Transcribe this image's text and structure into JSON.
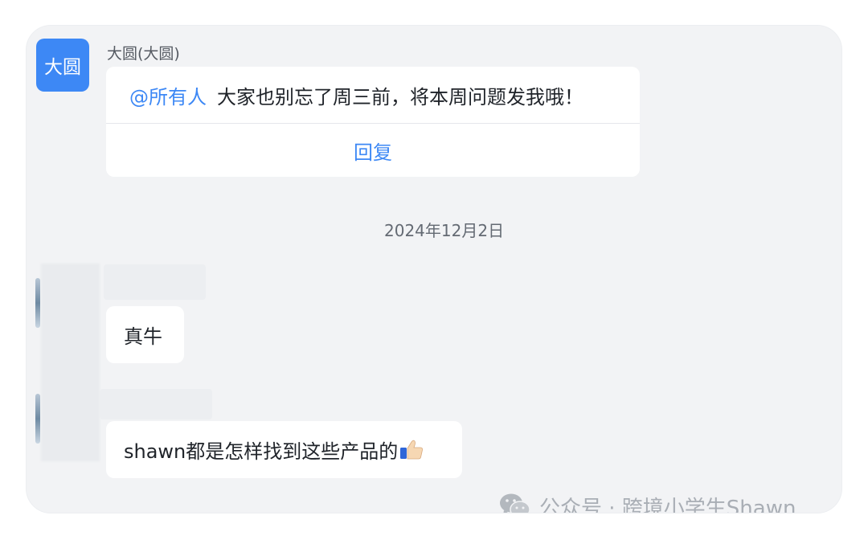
{
  "notice_message": {
    "avatar_text": "大圆",
    "sender": "大圆(大圆)",
    "mention": "@所有人",
    "text": "大家也别忘了周三前，将本周问题发我哦！",
    "reply_label": "回复"
  },
  "date_divider": "2024年12月2日",
  "messages": [
    {
      "text": "真牛"
    },
    {
      "text": "shawn都是怎样找到这些产品的"
    }
  ],
  "watermark": {
    "icon": "wechat-icon",
    "text": "公众号 · 跨境小学生Shawn"
  },
  "colors": {
    "accent": "#3d88f5",
    "background": "#f2f3f5",
    "bubble": "#ffffff"
  }
}
